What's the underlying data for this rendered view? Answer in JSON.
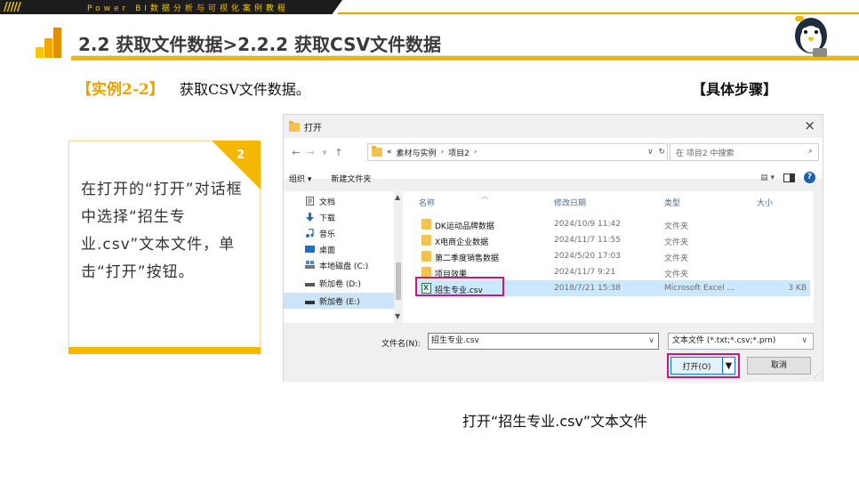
{
  "header": {
    "brand_text": "Power BI数据分析与可视化案例教程",
    "stripes": "/////",
    "page_title": "2.2  获取文件数据>2.2.2  获取CSV文件数据"
  },
  "example": {
    "tag": "【实例2-2】",
    "text": "获取CSV文件数据。",
    "steps_tag": "【具体步骤】"
  },
  "card": {
    "number": "2",
    "text": "在打开的“打开”对话框中选择“招生专业.csv”文本文件，单击“打开”按钮。"
  },
  "dialog": {
    "title": "打开",
    "close": "×",
    "nav": {
      "back": "←",
      "forward": "→",
      "dropdown": "▾",
      "up": "↑"
    },
    "breadcrumb": [
      "«",
      "素材与实例",
      "项目2"
    ],
    "breadcrumb_sep": "›",
    "address_dropdown": "∨",
    "refresh": "↻",
    "search_placeholder": "在 项目2 中搜索",
    "search_icon": "⌕",
    "toolbar": {
      "organize": "组织 ▾",
      "new_folder": "新建文件夹",
      "view_icon": "▤ ▾"
    },
    "nav_items": [
      "文档",
      "下载",
      "音乐",
      "桌面",
      "本地磁盘 (C:)",
      "新加卷 (D:)",
      "新加卷 (E:)"
    ],
    "columns": {
      "name": "名称",
      "date": "修改日期",
      "type": "类型",
      "size": "大小"
    },
    "files": [
      {
        "name": "DK运动品牌数据",
        "date": "2024/10/9 11:42",
        "type": "文件夹",
        "size": "",
        "kind": "folder"
      },
      {
        "name": "X电商企业数据",
        "date": "2024/11/7 11:55",
        "type": "文件夹",
        "size": "",
        "kind": "folder"
      },
      {
        "name": "第二季度销售数据",
        "date": "2024/5/20 17:03",
        "type": "文件夹",
        "size": "",
        "kind": "folder"
      },
      {
        "name": "项目效果",
        "date": "2024/11/7 9:21",
        "type": "文件夹",
        "size": "",
        "kind": "folder"
      },
      {
        "name": "招生专业.csv",
        "date": "2018/7/21 15:38",
        "type": "Microsoft Excel ...",
        "size": "3 KB",
        "kind": "excel"
      }
    ],
    "filename_label": "文件名(N):",
    "filename_value": "招生专业.csv",
    "filetype_value": "文本文件 (*.txt;*.csv;*.prn)",
    "open_button": "打开(O)",
    "cancel_button": "取消",
    "colors": {
      "highlight": "#d4147c",
      "selection": "#cce8ff"
    }
  },
  "caption": "打开“招生专业.csv”文本文件"
}
